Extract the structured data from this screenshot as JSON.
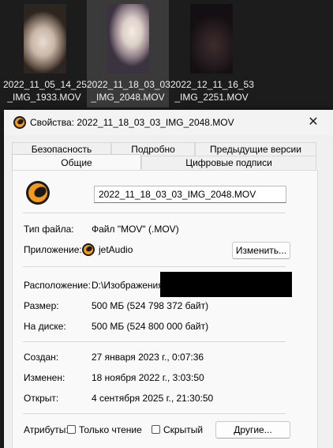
{
  "files": [
    {
      "name_line1": "2022_11_05_14_25",
      "name_line2": "_IMG_1933.MOV"
    },
    {
      "name_line1": "2022_11_18_03_03",
      "name_line2": "_IMG_2048.MOV"
    },
    {
      "name_line1": "2022_12_11_16_53",
      "name_line2": "_IMG_2251.MOV"
    }
  ],
  "dialog": {
    "title": "Свойства: 2022_11_18_03_03_IMG_2048.MOV",
    "close_glyph": "✕",
    "tabs_back": [
      "Безопасность",
      "Подробно",
      "Предыдущие версии"
    ],
    "tabs_front": [
      "Общие",
      "Цифровые подписи"
    ],
    "filename": "2022_11_18_03_03_IMG_2048.MOV",
    "file_type_label": "Тип файла:",
    "file_type_value": "Файл \"MOV\" (.MOV)",
    "app_label": "Приложение:",
    "app_value": "jetAudio",
    "change_button": "Изменить...",
    "location_label": "Расположение:",
    "location_value": "D:\\Изображения\\",
    "size_label": "Размер:",
    "size_value": "500 МБ (524 798 372 байт)",
    "disk_label": "На диске:",
    "disk_value": "500 МБ (524 800 000 байт)",
    "created_label": "Создан:",
    "created_value": "27 января 2023 г., 0:07:36",
    "modified_label": "Изменен:",
    "modified_value": "18 ноября 2022 г., 3:03:50",
    "opened_label": "Открыт:",
    "opened_value": "4 сентября 2025 г., 21:30:50",
    "attributes_label": "Атрибуты:",
    "readonly_label": "Только чтение",
    "hidden_label": "Скрытый",
    "other_button": "Другие..."
  },
  "colors": {
    "accent_icon": "#f29a1a",
    "dialog_bg": "#f0f0f0",
    "explorer_bg": "#1c1c1c"
  }
}
